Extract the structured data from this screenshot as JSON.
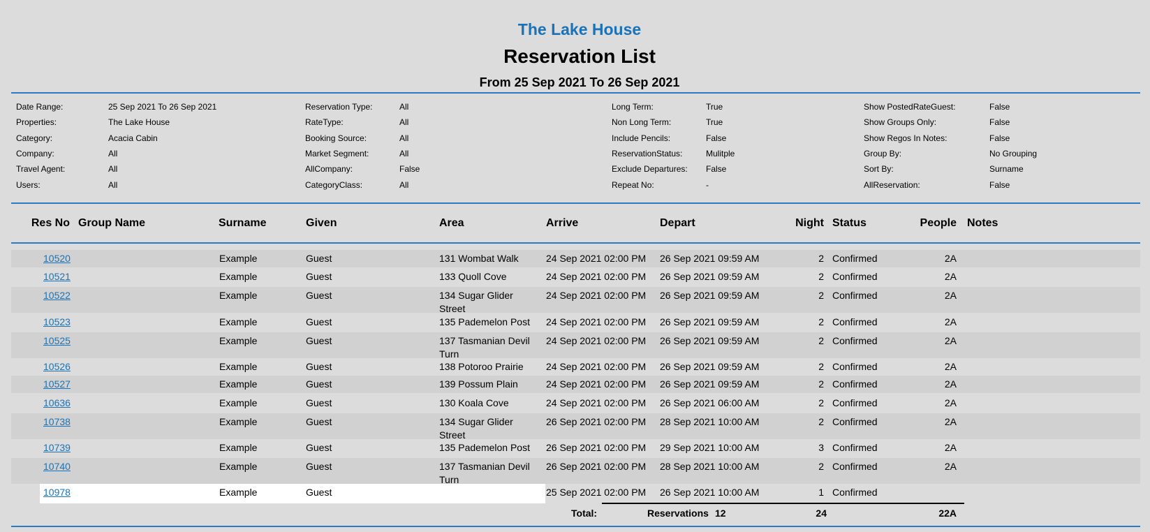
{
  "header": {
    "org_name": "The Lake House",
    "title": "Reservation List",
    "range": "From 25 Sep 2021 To 26 Sep 2021"
  },
  "params": [
    {
      "label": "Date Range:",
      "value": "25 Sep 2021 To 26 Sep 2021"
    },
    {
      "label": "Properties:",
      "value": "The Lake House"
    },
    {
      "label": "Category:",
      "value": "Acacia Cabin"
    },
    {
      "label": "Company:",
      "value": "All"
    },
    {
      "label": "Travel Agent:",
      "value": "All"
    },
    {
      "label": "Users:",
      "value": "All"
    },
    {
      "label": "Reservation Type:",
      "value": "All"
    },
    {
      "label": "RateType:",
      "value": "All"
    },
    {
      "label": "Booking Source:",
      "value": "All"
    },
    {
      "label": "Market Segment:",
      "value": "All"
    },
    {
      "label": "AllCompany:",
      "value": "False"
    },
    {
      "label": "CategoryClass:",
      "value": "All"
    },
    {
      "label": "Long Term:",
      "value": "True"
    },
    {
      "label": "Non Long Term:",
      "value": "True"
    },
    {
      "label": "Include Pencils:",
      "value": "False"
    },
    {
      "label": "ReservationStatus:",
      "value": "Mulitple"
    },
    {
      "label": "Exclude Departures:",
      "value": "False"
    },
    {
      "label": "Repeat No:",
      "value": "-"
    },
    {
      "label": "Show PostedRateGuest:",
      "value": "False"
    },
    {
      "label": "Show Groups Only:",
      "value": "False"
    },
    {
      "label": "Show Regos In Notes:",
      "value": "False"
    },
    {
      "label": "Group By:",
      "value": "No Grouping"
    },
    {
      "label": "Sort By:",
      "value": "Surname"
    },
    {
      "label": "AllReservation:",
      "value": "False"
    }
  ],
  "columns": [
    "Res No",
    "Group Name",
    "Surname",
    "Given",
    "Area",
    "Arrive",
    "Depart",
    "Night",
    "Status",
    "People",
    "Notes"
  ],
  "rows": [
    {
      "res_no": "10520",
      "group": "",
      "surname": "Example",
      "given": "Guest",
      "area": "131 Wombat Walk",
      "arrive": "24 Sep 2021 02:00 PM",
      "depart": "26 Sep 2021 09:59 AM",
      "night": "2",
      "status": "Confirmed",
      "people": "2A",
      "notes": ""
    },
    {
      "res_no": "10521",
      "group": "",
      "surname": "Example",
      "given": "Guest",
      "area": "133 Quoll Cove",
      "arrive": "24 Sep 2021 02:00 PM",
      "depart": "26 Sep 2021 09:59 AM",
      "night": "2",
      "status": "Confirmed",
      "people": "2A",
      "notes": ""
    },
    {
      "res_no": "10522",
      "group": "",
      "surname": "Example",
      "given": "Guest",
      "area": "134 Sugar Glider Street",
      "arrive": "24 Sep 2021 02:00 PM",
      "depart": "26 Sep 2021 09:59 AM",
      "night": "2",
      "status": "Confirmed",
      "people": "2A",
      "notes": ""
    },
    {
      "res_no": "10523",
      "group": "",
      "surname": "Example",
      "given": "Guest",
      "area": "135 Pademelon Post",
      "arrive": "24 Sep 2021 02:00 PM",
      "depart": "26 Sep 2021 09:59 AM",
      "night": "2",
      "status": "Confirmed",
      "people": "2A",
      "notes": ""
    },
    {
      "res_no": "10525",
      "group": "",
      "surname": "Example",
      "given": "Guest",
      "area": "137 Tasmanian Devil Turn",
      "arrive": "24 Sep 2021 02:00 PM",
      "depart": "26 Sep 2021 09:59 AM",
      "night": "2",
      "status": "Confirmed",
      "people": "2A",
      "notes": ""
    },
    {
      "res_no": "10526",
      "group": "",
      "surname": "Example",
      "given": "Guest",
      "area": "138 Potoroo Prairie",
      "arrive": "24 Sep 2021 02:00 PM",
      "depart": "26 Sep 2021 09:59 AM",
      "night": "2",
      "status": "Confirmed",
      "people": "2A",
      "notes": ""
    },
    {
      "res_no": "10527",
      "group": "",
      "surname": "Example",
      "given": "Guest",
      "area": "139 Possum Plain",
      "arrive": "24 Sep 2021 02:00 PM",
      "depart": "26 Sep 2021 09:59 AM",
      "night": "2",
      "status": "Confirmed",
      "people": "2A",
      "notes": ""
    },
    {
      "res_no": "10636",
      "group": "",
      "surname": "Example",
      "given": "Guest",
      "area": "130 Koala Cove",
      "arrive": "24 Sep 2021 02:00 PM",
      "depart": "26 Sep 2021 06:00 AM",
      "night": "2",
      "status": "Confirmed",
      "people": "2A",
      "notes": ""
    },
    {
      "res_no": "10738",
      "group": "",
      "surname": "Example",
      "given": "Guest",
      "area": "134 Sugar Glider Street",
      "arrive": "26 Sep 2021 02:00 PM",
      "depart": "28 Sep 2021 10:00 AM",
      "night": "2",
      "status": "Confirmed",
      "people": "2A",
      "notes": ""
    },
    {
      "res_no": "10739",
      "group": "",
      "surname": "Example",
      "given": "Guest",
      "area": "135 Pademelon Post",
      "arrive": "26 Sep 2021 02:00 PM",
      "depart": "29 Sep 2021 10:00 AM",
      "night": "3",
      "status": "Confirmed",
      "people": "2A",
      "notes": ""
    },
    {
      "res_no": "10740",
      "group": "",
      "surname": "Example",
      "given": "Guest",
      "area": "137 Tasmanian Devil Turn",
      "arrive": "26 Sep 2021 02:00 PM",
      "depart": "28 Sep 2021 10:00 AM",
      "night": "2",
      "status": "Confirmed",
      "people": "2A",
      "notes": ""
    },
    {
      "res_no": "10978",
      "group": "",
      "surname": "Example",
      "given": "Guest",
      "area": "",
      "arrive": "25 Sep 2021 02:00 PM",
      "depart": "26 Sep 2021 10:00 AM",
      "night": "1",
      "status": "Confirmed",
      "people": "",
      "notes": ""
    }
  ],
  "totals": {
    "label": "Total:",
    "reservations_label": "Reservations",
    "reservations": "12",
    "nights": "24",
    "people": "22A"
  }
}
